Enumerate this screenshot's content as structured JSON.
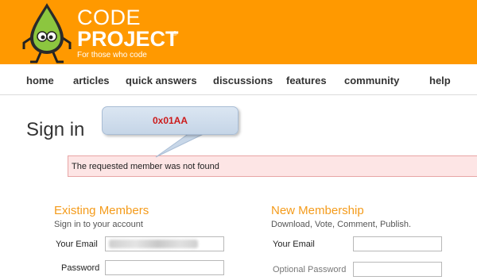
{
  "logo": {
    "word1": "CODE",
    "word2": "PROJECT",
    "reg": "®",
    "tagline": "For those who code"
  },
  "nav": {
    "items": [
      "home",
      "articles",
      "quick answers",
      "discussions",
      "features",
      "community",
      "help"
    ]
  },
  "page": {
    "title": "Sign in"
  },
  "callout": {
    "text": "0x01AA"
  },
  "error": {
    "message": "The requested member was not found"
  },
  "existing": {
    "title": "Existing Members",
    "subtitle": "Sign in to your account",
    "email_label": "Your Email",
    "password_label": "Password"
  },
  "newmember": {
    "title": "New Membership",
    "subtitle": "Download, Vote, Comment, Publish.",
    "email_label": "Your Email",
    "password_label": "Optional Password"
  },
  "colors": {
    "header": "#ff9900",
    "accent": "#f49b1b",
    "error_bg": "#fde5e5",
    "callout_text": "#cc1a1a"
  }
}
